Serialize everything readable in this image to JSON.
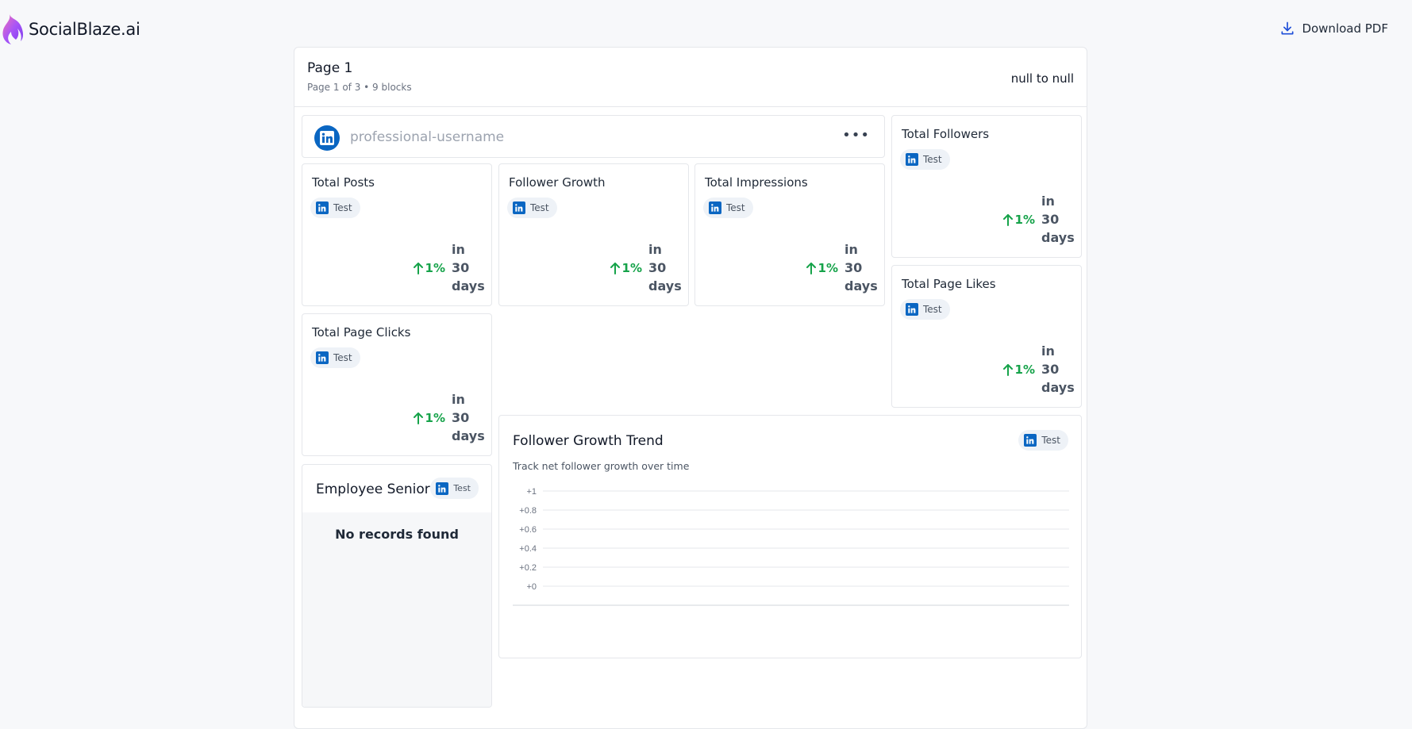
{
  "brand": {
    "name": "SocialBlaze.ai"
  },
  "toolbar": {
    "download_label": "Download PDF"
  },
  "page": {
    "title": "Page 1",
    "subtitle": "Page 1 of 3 • 9 blocks",
    "date_range": "null to null"
  },
  "profile": {
    "username": "professional-username",
    "more_label": "•••"
  },
  "metrics": [
    {
      "title": "Total Posts",
      "tag": "Test",
      "change": "1%",
      "period": "in 30 days"
    },
    {
      "title": "Follower Growth",
      "tag": "Test",
      "change": "1%",
      "period": "in 30 days"
    },
    {
      "title": "Total Impressions",
      "tag": "Test",
      "change": "1%",
      "period": "in 30 days"
    },
    {
      "title": "Total Followers",
      "tag": "Test",
      "change": "1%",
      "period": "in 30 days"
    },
    {
      "title": "Total Page Likes",
      "tag": "Test",
      "change": "1%",
      "period": "in 30 days"
    },
    {
      "title": "Total Page Clicks",
      "tag": "Test",
      "change": "1%",
      "period": "in 30 days"
    }
  ],
  "employee": {
    "title": "Employee Senior",
    "tag": "Test",
    "empty_text": "No records found"
  },
  "trend": {
    "title": "Follower Growth Trend",
    "subtitle": "Track net follower growth over time",
    "tag": "Test"
  },
  "chart_data": {
    "type": "line",
    "title": "Follower Growth Trend",
    "x": [],
    "series": [],
    "ylim": [
      0,
      1
    ],
    "y_ticks": [
      "+1",
      "+0.8",
      "+0.6",
      "+0.4",
      "+0.2",
      "+0"
    ],
    "grid": true
  },
  "colors": {
    "linkedin": "#0a66c2",
    "positive": "#16a34a"
  }
}
